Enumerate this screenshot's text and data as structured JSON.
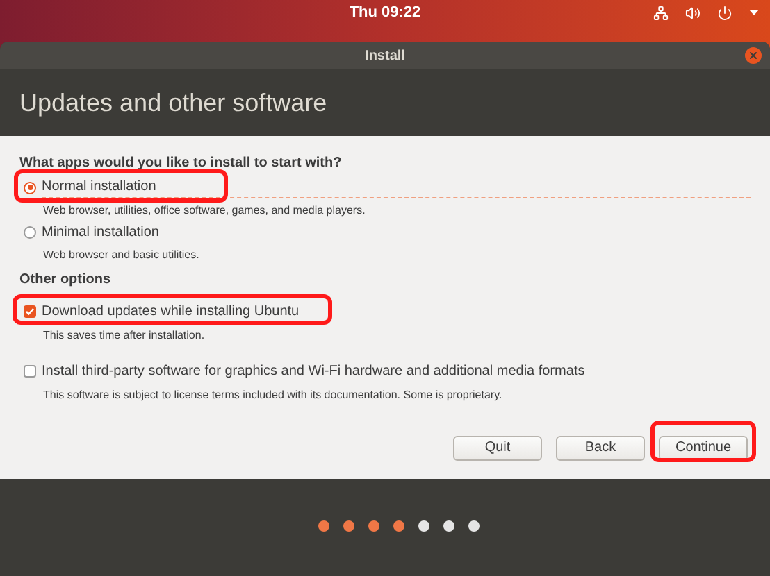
{
  "top_bar": {
    "clock": "Thu 09:22"
  },
  "window": {
    "title": "Install"
  },
  "header": {
    "title": "Updates and other software"
  },
  "install_type": {
    "question": "What apps would you like to install to start with?",
    "options": [
      {
        "label": "Normal installation",
        "description": "Web browser, utilities, office software, games, and media players.",
        "selected": true,
        "highlighted": true
      },
      {
        "label": "Minimal installation",
        "description": "Web browser and basic utilities.",
        "selected": false,
        "highlighted": false
      }
    ]
  },
  "other_options": {
    "heading": "Other options",
    "items": [
      {
        "label": "Download updates while installing Ubuntu",
        "description": "This saves time after installation.",
        "checked": true,
        "highlighted": true
      },
      {
        "label": "Install third-party software for graphics and Wi-Fi hardware and additional media formats",
        "description": "This software is subject to license terms included with its documentation. Some is proprietary.",
        "checked": false,
        "highlighted": false
      }
    ]
  },
  "buttons": [
    {
      "label": "Quit",
      "highlighted": false
    },
    {
      "label": "Back",
      "highlighted": false
    },
    {
      "label": "Continue",
      "highlighted": true
    }
  ],
  "progress_steps": [
    {
      "done": true
    },
    {
      "done": true
    },
    {
      "done": true
    },
    {
      "done": true
    },
    {
      "done": false
    },
    {
      "done": false
    },
    {
      "done": false
    }
  ]
}
